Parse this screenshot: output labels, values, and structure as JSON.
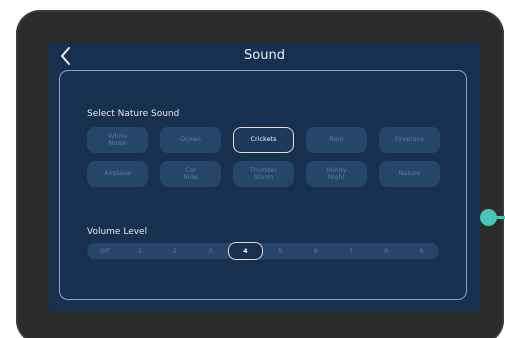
{
  "screen": {
    "title": "Sound",
    "back_icon": "chevron-left-icon"
  },
  "sounds": {
    "label": "Select Nature Sound",
    "selected": "Crickets",
    "options": [
      "White\nNoise",
      "Ocean",
      "Crickets",
      "Rain",
      "Fireplace",
      "Airplane",
      "Car\nRide",
      "Thunder\nStorm",
      "Windy\nNight",
      "Nature"
    ]
  },
  "volume": {
    "label": "Volume Level",
    "selected": "4",
    "levels": [
      "Off",
      "1",
      "2",
      "3",
      "4",
      "5",
      "6",
      "7",
      "8",
      "9"
    ]
  },
  "colors": {
    "screen_bg": "#17304f",
    "chip_bg": "#254569",
    "chip_text": "#5e7c9f",
    "selected_border": "#e8d9cf",
    "accent_dot": "#45c6b7"
  }
}
